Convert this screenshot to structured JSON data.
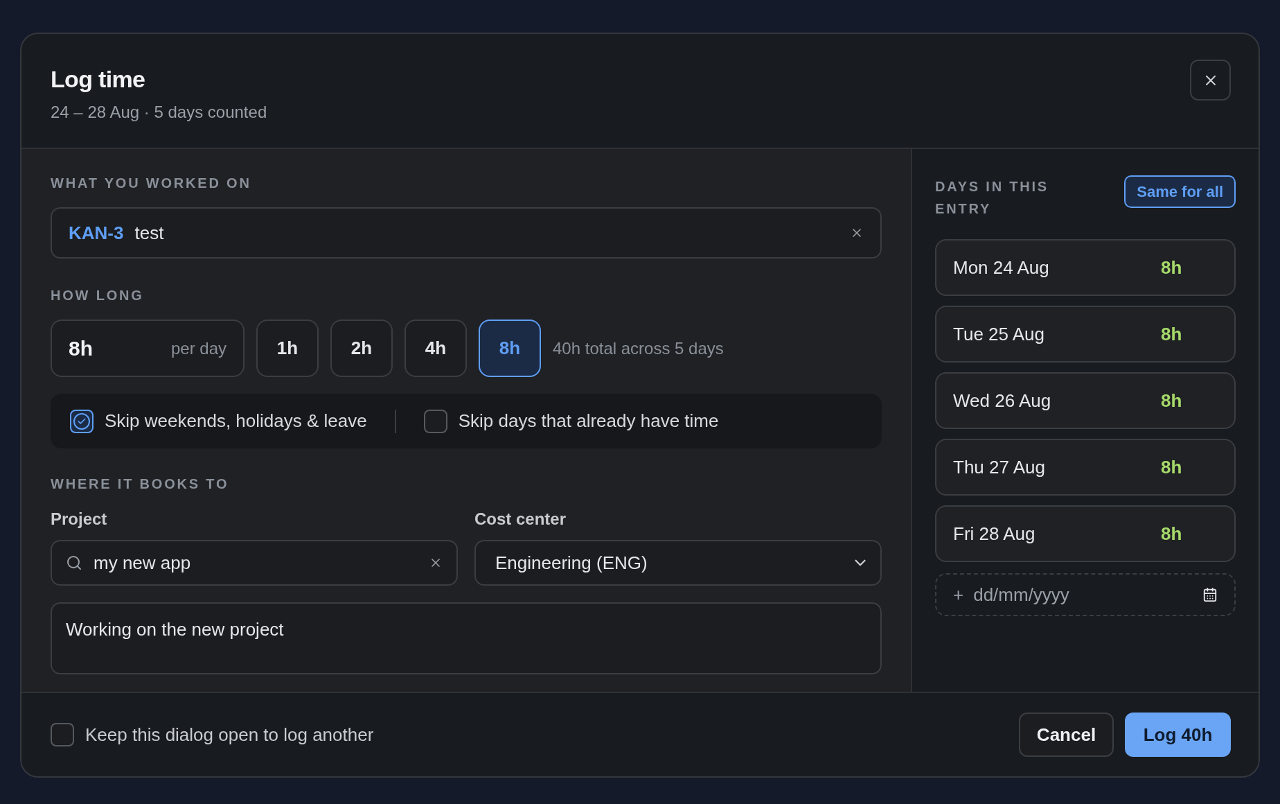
{
  "dialog": {
    "title": "Log time",
    "subtitle": "24 – 28 Aug · 5 days counted"
  },
  "work": {
    "label": "WHAT YOU WORKED ON",
    "issue_key": "KAN-3",
    "issue_title": "test"
  },
  "duration": {
    "label": "HOW LONG",
    "value": "8h",
    "unit": "per day",
    "presets": [
      {
        "label": "1h",
        "selected": false
      },
      {
        "label": "2h",
        "selected": false
      },
      {
        "label": "4h",
        "selected": false
      },
      {
        "label": "8h",
        "selected": true
      }
    ],
    "summary": "40h total across 5 days"
  },
  "options": [
    {
      "label": "Skip weekends, holidays & leave",
      "checked": true
    },
    {
      "label": "Skip days that already have time",
      "checked": false
    }
  ],
  "booking": {
    "label": "WHERE IT BOOKS TO",
    "project_label": "Project",
    "project_value": "my new app",
    "cost_center_label": "Cost center",
    "cost_center_value": "Engineering (ENG)",
    "description": "Working on the new project"
  },
  "days": {
    "label": "DAYS IN THIS ENTRY",
    "same_button": "Same for all",
    "items": [
      {
        "date": "Mon 24 Aug",
        "hours": "8h"
      },
      {
        "date": "Tue 25 Aug",
        "hours": "8h"
      },
      {
        "date": "Wed 26 Aug",
        "hours": "8h"
      },
      {
        "date": "Thu 27 Aug",
        "hours": "8h"
      },
      {
        "date": "Fri 28 Aug",
        "hours": "8h"
      }
    ],
    "add_prefix": "+",
    "add_placeholder": "dd/mm/yyyy"
  },
  "footer": {
    "keep_open": {
      "label": "Keep this dialog open to log another",
      "checked": false
    },
    "cancel": "Cancel",
    "submit": "Log 40h"
  }
}
